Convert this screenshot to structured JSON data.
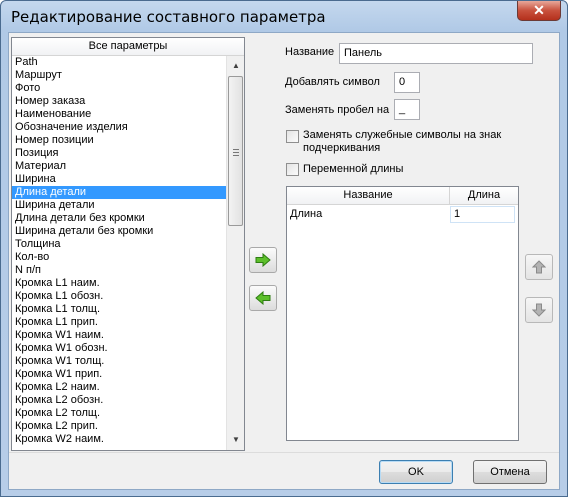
{
  "window": {
    "title": "Редактирование составного параметра",
    "close_label": "✕"
  },
  "params_list": {
    "header": "Все параметры",
    "items": [
      "Path",
      "Маршрут",
      "Фото",
      "Номер заказа",
      "Наименование",
      "Обозначение изделия",
      "Номер позиции",
      "Позиция",
      "Материал",
      "Ширина",
      "Длина детали",
      "Ширина детали",
      "Длина детали без кромки",
      "Ширина детали без кромки",
      "Толщина",
      "Кол-во",
      "N п/п",
      "Кромка L1 наим.",
      "Кромка L1 обозн.",
      "Кромка L1 толщ.",
      "Кромка L1 прип.",
      "Кромка W1 наим.",
      "Кромка W1 обозн.",
      "Кромка W1 толщ.",
      "Кромка W1 прип.",
      "Кромка L2 наим.",
      "Кромка L2 обозн.",
      "Кромка L2 толщ.",
      "Кромка L2 прип.",
      "Кромка W2 наим."
    ],
    "selected_index": 10
  },
  "form": {
    "name_label": "Название",
    "name_value": "Панель",
    "add_symbol_label": "Добавлять символ",
    "add_symbol_value": "0",
    "replace_space_label": "Заменять пробел на",
    "replace_space_value": "_",
    "replace_special_label_1": "Заменять служебные символы на знак",
    "replace_special_label_2": "подчеркивания",
    "variable_length_label": "Переменной длины"
  },
  "table": {
    "columns": [
      "Название",
      "Длина"
    ],
    "rows": [
      {
        "name": "Длина",
        "length": "1"
      }
    ]
  },
  "icons": {
    "add": "arrow-right-green-icon",
    "remove": "arrow-left-green-icon",
    "up": "arrow-up-gray-icon",
    "down": "arrow-down-gray-icon",
    "accent_green": "#4caf1e"
  },
  "buttons": {
    "ok": "OK",
    "cancel": "Отмена"
  }
}
